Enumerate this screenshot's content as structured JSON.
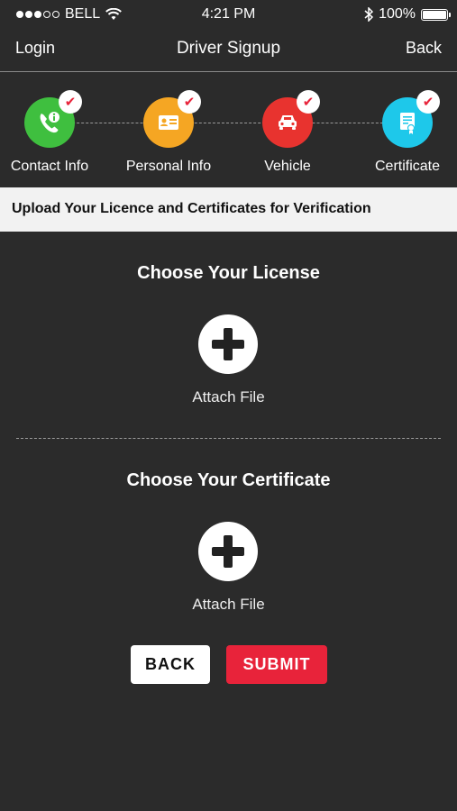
{
  "status_bar": {
    "carrier": "BELL",
    "time": "4:21 PM",
    "battery": "100%"
  },
  "nav": {
    "left_label": "Login",
    "title": "Driver Signup",
    "right_label": "Back"
  },
  "steps": [
    {
      "label": "Contact Info",
      "color": "#3fbf3f",
      "icon": "phone-info-icon",
      "completed": true
    },
    {
      "label": "Personal Info",
      "color": "#f5a623",
      "icon": "id-card-icon",
      "completed": true
    },
    {
      "label": "Vehicle",
      "color": "#e8332f",
      "icon": "car-icon",
      "completed": true
    },
    {
      "label": "Certificate",
      "color": "#1ec8ea",
      "icon": "certificate-icon",
      "completed": true
    }
  ],
  "banner": {
    "text": "Upload Your Licence and Certificates for Verification"
  },
  "license": {
    "title": "Choose Your License",
    "attach_label": "Attach File"
  },
  "certificate": {
    "title": "Choose Your Certificate",
    "attach_label": "Attach File"
  },
  "buttons": {
    "back": "BACK",
    "submit": "SUBMIT"
  },
  "colors": {
    "background": "#2b2b2b",
    "accent": "#e8233a",
    "banner_bg": "#f2f2f2"
  }
}
